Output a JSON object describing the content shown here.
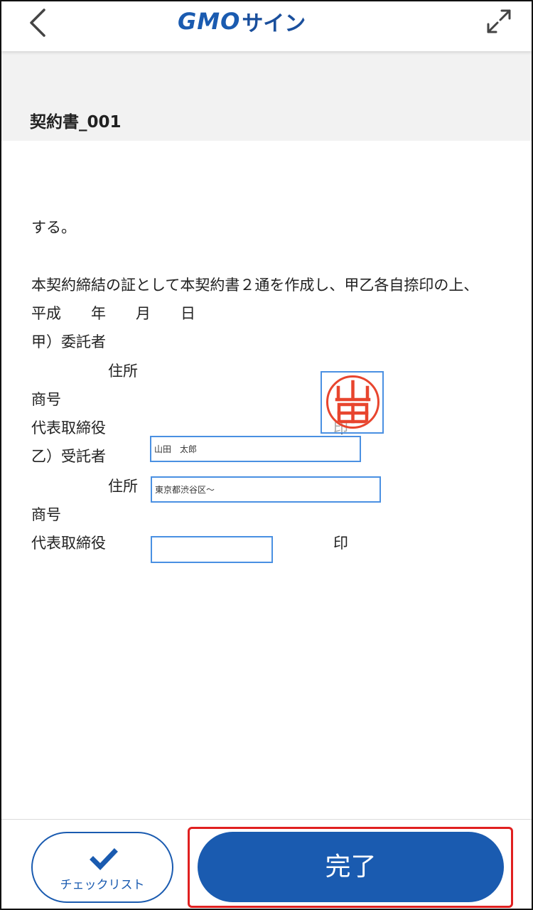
{
  "header": {
    "logo_gmo": "GMO",
    "logo_sign": "サイン"
  },
  "document": {
    "title": "契約書_001",
    "lines": [
      "する。",
      "本契約締結の証として本契約書２通を作成し、甲乙各自捺印の上、",
      "平成　　年　　月　　日",
      "甲）委託者",
      "住所",
      "商号",
      "代表取締役",
      "印",
      "乙）受託者",
      "住所",
      "商号",
      "代表取締役",
      "印"
    ],
    "fields": {
      "name_value": "山田　太郎",
      "address_value": "東京都渋谷区〜",
      "signature_value": ""
    },
    "seal_text": "山田"
  },
  "footer": {
    "checklist_label": "チェックリスト",
    "complete_label": "完了"
  },
  "colors": {
    "brand_blue": "#1a5bb0",
    "field_border": "#4a90e2",
    "seal_red": "#e8452e",
    "highlight_red": "#e02020"
  }
}
